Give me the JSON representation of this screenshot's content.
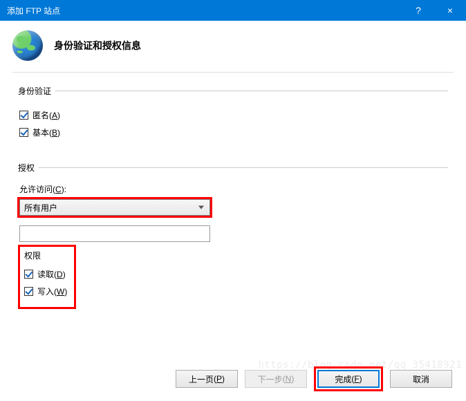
{
  "titlebar": {
    "title": "添加 FTP 站点",
    "help": "?",
    "close": "×"
  },
  "header": {
    "title": "身份验证和授权信息"
  },
  "auth": {
    "legend": "身份验证",
    "anonymous_label": "匿名",
    "anonymous_key": "A",
    "anonymous_checked": true,
    "basic_label": "基本",
    "basic_key": "B",
    "basic_checked": true
  },
  "authorization": {
    "legend": "授权",
    "allow_label": "允许访问",
    "allow_key": "C",
    "select_value": "所有用户",
    "textbox_value": ""
  },
  "permissions": {
    "legend": "权限",
    "read_label": "读取",
    "read_key": "D",
    "read_checked": true,
    "write_label": "写入",
    "write_key": "W",
    "write_checked": true
  },
  "footer": {
    "prev": "上一页",
    "prev_key": "P",
    "next": "下一步",
    "next_key": "N",
    "finish": "完成",
    "finish_key": "F",
    "cancel": "取消"
  },
  "watermark": "https://blog.csdn.net/qq_35418921"
}
